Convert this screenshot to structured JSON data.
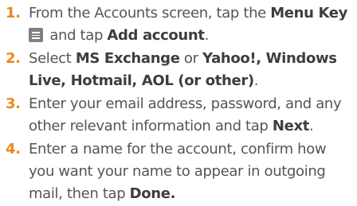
{
  "steps": [
    {
      "number": "1.",
      "parts": {
        "t1": "From the Accounts screen, tap the ",
        "b1": "Menu Key",
        "t2": " and tap ",
        "b2": "Add account",
        "t3": "."
      },
      "icon": "menu-key-icon"
    },
    {
      "number": "2.",
      "parts": {
        "t1": "Select ",
        "b1": "MS Exchange",
        "t2": " or ",
        "b2": "Yahoo!, Windows Live, Hotmail, AOL (or other)",
        "t3": "."
      }
    },
    {
      "number": "3.",
      "parts": {
        "t1": "Enter your email address, password, and any other relevant information and tap ",
        "b1": "Next",
        "t2": "."
      }
    },
    {
      "number": "4.",
      "parts": {
        "t1": "Enter a name for the account, confirm how you want your name to appear in outgoing mail, then tap ",
        "b1": "Done."
      }
    }
  ],
  "colors": {
    "number": "#e8891d",
    "text": "#555555",
    "bold": "#3d3d3d",
    "icon": "#808080"
  }
}
